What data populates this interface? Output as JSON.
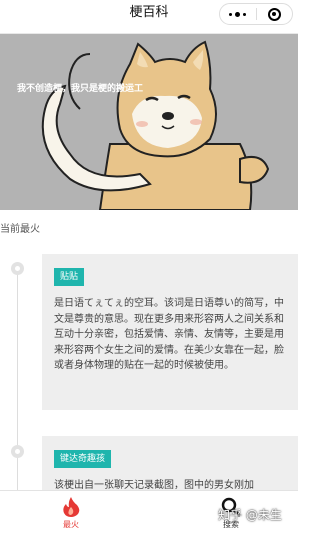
{
  "navbar": {
    "title": "梗百科"
  },
  "banner": {
    "text": "我不创造梗，我只是梗的搬运工"
  },
  "section": {
    "title": "当前最火"
  },
  "cards": [
    {
      "tag": "贴贴",
      "text": "是日语てぇてぇ的空耳。该词是日语尊い的简写，中文是尊贵的意思。现在更多用来形容两人之间关系和互动十分亲密，包括爱情、亲情、友情等，主要是用来形容两个女生之间的爱情。在美少女靠在一起，脸或者身体物理的贴在一起的时候被使用。"
    },
    {
      "tag": "键达奇趣孩",
      "text": "该梗出自一张聊天记录截图，图中的男女刚加"
    }
  ],
  "tabbar": {
    "hot_label": "最火",
    "search_label": "搜索"
  },
  "watermark": "知乎 @未生",
  "colors": {
    "tag": "#1fb5ad",
    "hot": "#e53935",
    "banner_bg": "#b3b3b3"
  },
  "icons": {
    "hot": "flame-icon",
    "search": "search-icon",
    "more": "more-dots-icon",
    "close": "close-circle-icon"
  }
}
